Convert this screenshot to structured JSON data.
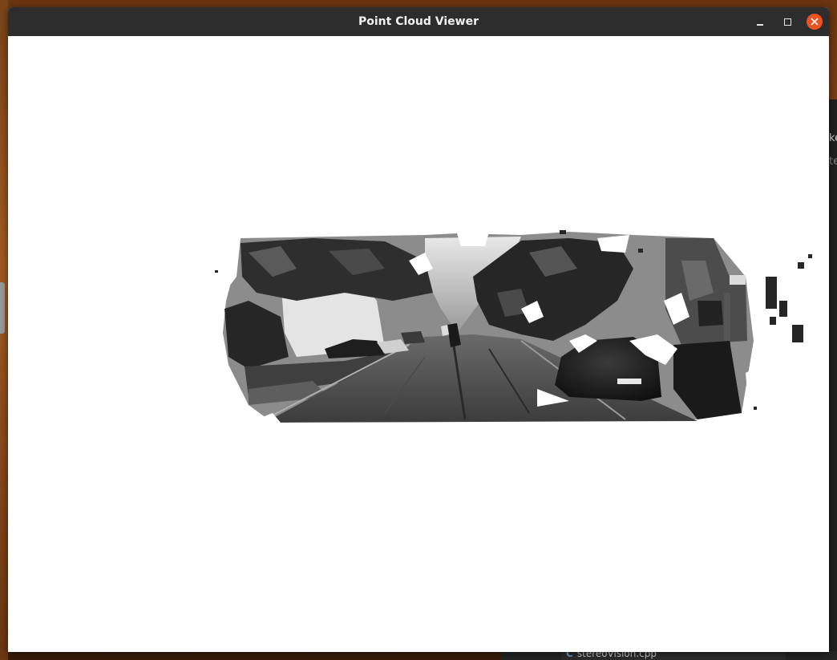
{
  "window": {
    "title": "Point Cloud Viewer",
    "controls": {
      "minimize": "minimize-icon",
      "maximize": "maximize-icon",
      "close": "close-icon"
    },
    "accent_color": "#e95420",
    "titlebar_color": "#2d2d2d",
    "viewport_background": "#ffffff"
  },
  "background_editor": {
    "right_partial_text_1": "ke",
    "right_partial_text_2": "te",
    "open_file": "stereoVision.cpp"
  }
}
